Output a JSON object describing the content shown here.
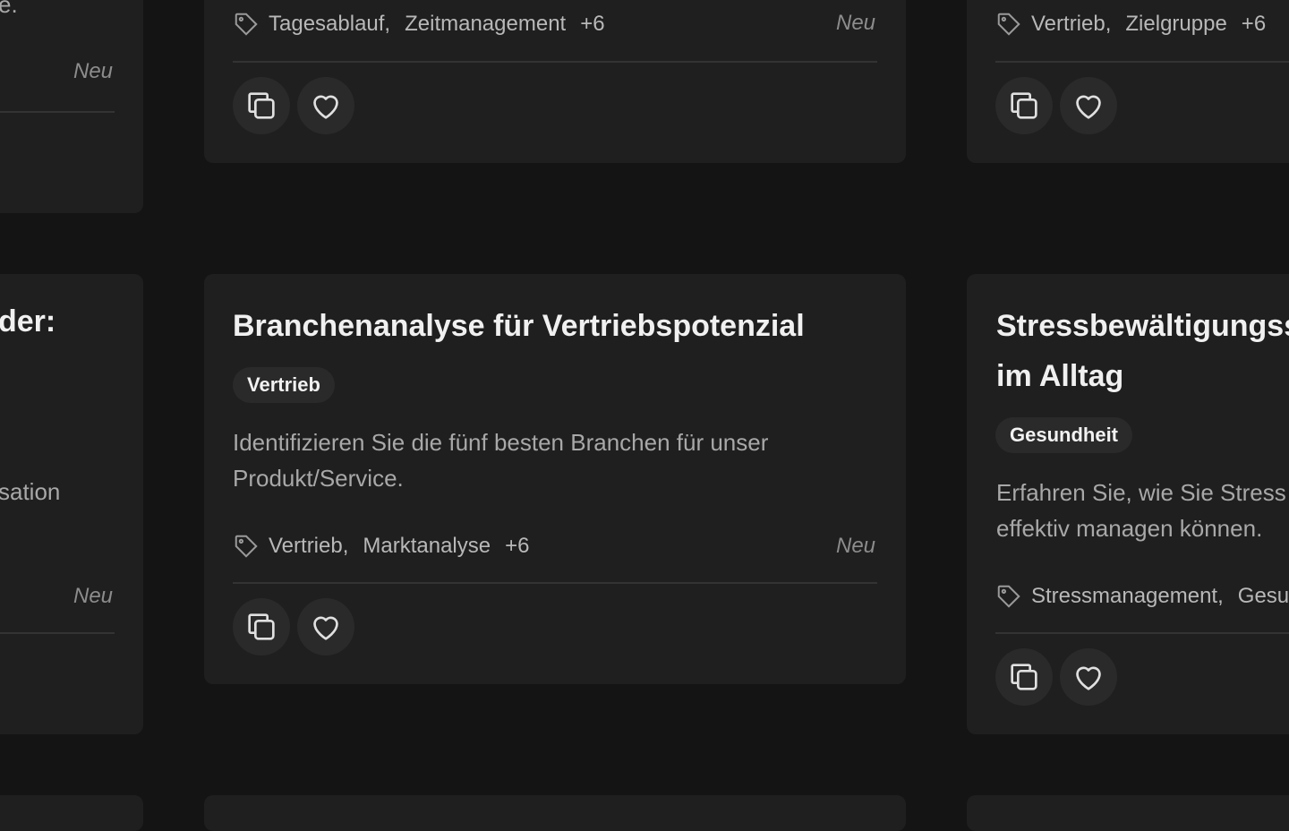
{
  "cards": {
    "left_top": {
      "desc_tail": "e.",
      "status": "Neu"
    },
    "center_top": {
      "tags": [
        "Tagesablauf,",
        "Zeitmanagement"
      ],
      "more": "+6",
      "status": "Neu"
    },
    "right_top": {
      "tags": [
        "Vertrieb,",
        "Zielgruppe"
      ],
      "more": "+6"
    },
    "left_mid": {
      "title_tail": "der:",
      "desc_tail": "sation",
      "status": "Neu"
    },
    "center_mid": {
      "title": "Branchenanalyse für Vertriebspotenzial",
      "category": "Vertrieb",
      "description": "Identifizieren Sie die fünf besten Branchen für unser Produkt/Service.",
      "tags": [
        "Vertrieb,",
        "Marktanalyse"
      ],
      "more": "+6",
      "status": "Neu"
    },
    "right_mid": {
      "title": "Stressbewältigungsstrategien im Alltag",
      "category": "Gesundheit",
      "description": "Erfahren Sie, wie Sie Stress effektiv managen können.",
      "tags": [
        "Stressmanagement,",
        "Gesundheit"
      ]
    }
  },
  "icons": {
    "copy": "copy-icon",
    "heart": "heart-icon",
    "tag": "tag-icon"
  },
  "colors": {
    "background": "#141414",
    "card": "#1f1f1f",
    "button": "#2a2a2a"
  }
}
